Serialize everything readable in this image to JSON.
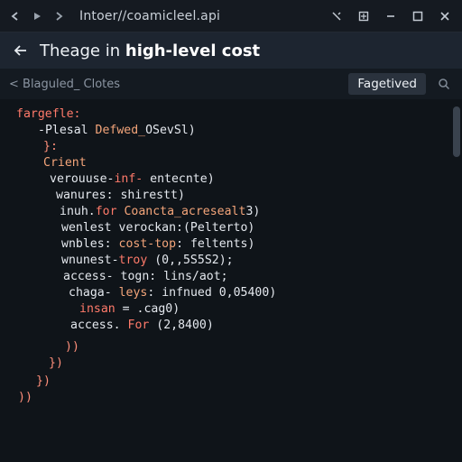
{
  "chrome": {
    "url": "Intoer//coamicleel.api",
    "back_icon": "chevron-left-icon",
    "forward_icon": "play-icon",
    "reload_icon": "chevron-right-icon"
  },
  "header": {
    "title_prefix": "Theage in",
    "title_bold": "high-level cost"
  },
  "subbar": {
    "breadcrumb": "< Blaguled_ Clotes",
    "button_label": "Fagetived"
  },
  "code": {
    "lines": [
      {
        "parts": [
          {
            "t": "fargefle:",
            "c": "kw"
          }
        ]
      },
      {
        "parts": [
          {
            "t": "-Plesal ",
            "c": "tx"
          },
          {
            "t": "Defwed_",
            "c": "fn"
          },
          {
            "t": "OSevSl)",
            "c": "tx"
          }
        ]
      },
      {
        "parts": [
          {
            "t": "}:",
            "c": "pn"
          }
        ]
      },
      {
        "parts": [
          {
            "t": "Crient",
            "c": "fn"
          }
        ]
      },
      {
        "parts": [
          {
            "t": "verouuse-",
            "c": "tx"
          },
          {
            "t": "inf-",
            "c": "kw"
          },
          {
            "t": " entecnte)",
            "c": "tx"
          }
        ]
      },
      {
        "parts": [
          {
            "t": "wanures: shirestt)",
            "c": "tx"
          }
        ]
      },
      {
        "parts": [
          {
            "t": "inuh.",
            "c": "tx"
          },
          {
            "t": "for ",
            "c": "kw"
          },
          {
            "t": "Coancta_acresealt",
            "c": "fn"
          },
          {
            "t": "3)",
            "c": "tx"
          }
        ]
      },
      {
        "parts": [
          {
            "t": "wenlest verockan:(Pelterto)",
            "c": "tx"
          }
        ]
      },
      {
        "parts": [
          {
            "t": "wnbles: ",
            "c": "tx"
          },
          {
            "t": "cost-top",
            "c": "fn"
          },
          {
            "t": ": feltents)",
            "c": "tx"
          }
        ]
      },
      {
        "parts": [
          {
            "t": "wnunest-",
            "c": "tx"
          },
          {
            "t": "troy",
            "c": "kw"
          },
          {
            "t": " (0,,5S5S2);",
            "c": "tx"
          }
        ]
      },
      {
        "parts": [
          {
            "t": "access- togn: lins/aot;",
            "c": "tx"
          }
        ]
      },
      {
        "parts": [
          {
            "t": "chaga- ",
            "c": "tx"
          },
          {
            "t": "leys",
            "c": "fn"
          },
          {
            "t": ": infnued 0,05400)",
            "c": "tx"
          }
        ]
      },
      {
        "parts": [
          {
            "t": "insan",
            "c": "kw"
          },
          {
            "t": " = .cag0)",
            "c": "tx"
          }
        ]
      },
      {
        "parts": [
          {
            "t": "access. ",
            "c": "tx"
          },
          {
            "t": "For",
            "c": "kw"
          },
          {
            "t": " (2,8400)",
            "c": "tx"
          }
        ]
      },
      {
        "parts": [
          {
            "t": "))",
            "c": "pn"
          }
        ]
      },
      {
        "parts": [
          {
            "t": "})",
            "c": "pn"
          }
        ]
      },
      {
        "parts": [
          {
            "t": "})",
            "c": "pn"
          }
        ]
      },
      {
        "parts": [
          {
            "t": "))",
            "c": "pn"
          }
        ]
      }
    ]
  }
}
